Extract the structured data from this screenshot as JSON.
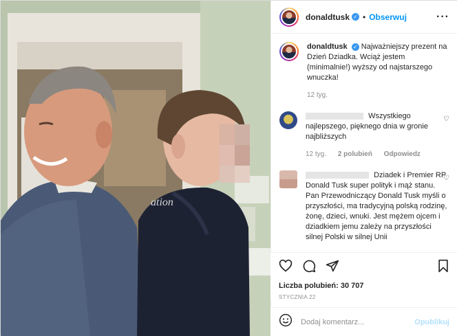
{
  "post": {
    "author": "donaldtusk",
    "verified_icon": "verified-badge-icon",
    "follow_label": "Obserwuj",
    "more_icon": "more-options-icon",
    "caption": "Najważniejszy prezent na Dzień Dziadka. Wciąż jestem (minimalnie!) wyższy od najstarszego wnuczka!",
    "caption_age": "12 tyg.",
    "likes_label": "Liczba polubień: 30 707",
    "date_label": "STYCZNIA 22"
  },
  "comments": [
    {
      "text": "Wszystkiego najlepszego, pięknego dnia w gronie najbliższych",
      "age": "12 tyg.",
      "likes": "2 polubień",
      "reply": "Odpowiedz"
    },
    {
      "text": "Dziadek i Premier RP Donald Tusk super polityk i mąż stanu. Pan Przewodniczący Donald Tusk myśli o przyszłości, ma tradycyjną polską rodzinę, żonę, dzieci, wnuki. Jest mężem ojcem i dziadkiem jemu zależy na przyszłości silnej Polski w silnej Unii"
    }
  ],
  "actions": {
    "like_icon": "heart-icon",
    "comment_icon": "comment-icon",
    "share_icon": "send-icon",
    "save_icon": "bookmark-icon"
  },
  "composer": {
    "emoji_icon": "emoji-icon",
    "placeholder": "Dodaj komentarz...",
    "publish_label": "Opublikuj"
  },
  "colors": {
    "link_blue": "#0095f6",
    "publish_disabled": "#b2dffc",
    "verified_blue": "#3897f0",
    "muted": "#8e8e8e"
  }
}
